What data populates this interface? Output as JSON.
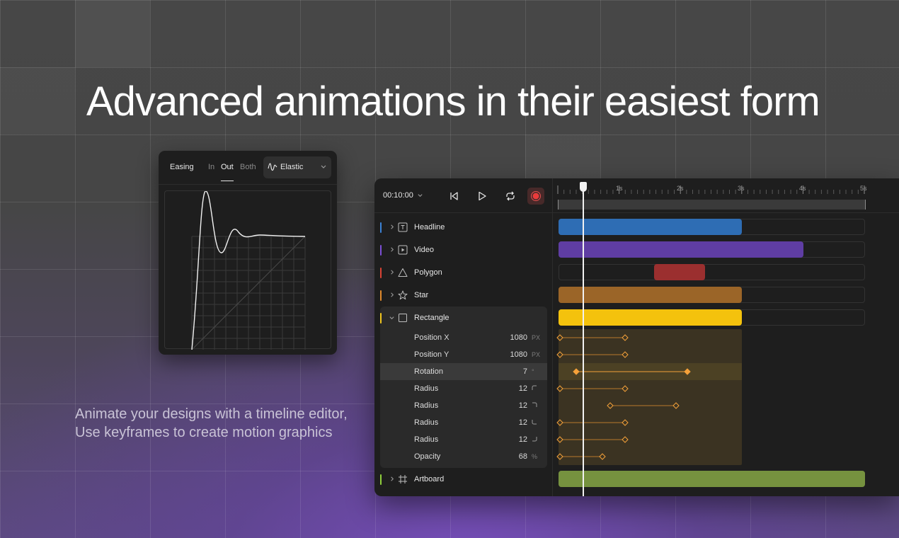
{
  "hero": {
    "headline": "Advanced animations in their easiest form",
    "subtext_line1": "Animate your designs with a timeline editor,",
    "subtext_line2": "Use keyframes to create motion graphics"
  },
  "easing_panel": {
    "title": "Easing",
    "tabs": [
      {
        "label": "In",
        "active": false
      },
      {
        "label": "Out",
        "active": true
      },
      {
        "label": "Both",
        "active": false
      }
    ],
    "preset_icon": "elastic-wave-icon",
    "preset": "Elastic"
  },
  "timeline": {
    "time": "00:10:00",
    "controls": [
      "skip-to-start-icon",
      "play-icon",
      "loop-icon",
      "record-icon"
    ],
    "ruler_labels": [
      "1s",
      "2s",
      "3s",
      "4s",
      "5s"
    ],
    "playhead_seconds": 0.4,
    "layers": [
      {
        "name": "Headline",
        "icon": "text-icon",
        "color": "#3b82d6",
        "expanded": false
      },
      {
        "name": "Video",
        "icon": "video-icon",
        "color": "#7c4fd6",
        "expanded": false
      },
      {
        "name": "Polygon",
        "icon": "triangle-icon",
        "color": "#d94335",
        "expanded": false
      },
      {
        "name": "Star",
        "icon": "star-icon",
        "color": "#e08a2c",
        "expanded": false
      },
      {
        "name": "Rectangle",
        "icon": "rectangle-icon",
        "color": "#f2c61f",
        "expanded": true
      },
      {
        "name": "Artboard",
        "icon": "artboard-icon",
        "color": "#8fcf3c",
        "expanded": false
      }
    ],
    "properties": [
      {
        "name": "Position X",
        "value": "1080",
        "unit": "PX"
      },
      {
        "name": "Position Y",
        "value": "1080",
        "unit": "PX"
      },
      {
        "name": "Rotation",
        "value": "7",
        "unit": "°",
        "selected": true
      },
      {
        "name": "Radius",
        "value": "12",
        "unit_icon": "corner-top-left-icon"
      },
      {
        "name": "Radius",
        "value": "12",
        "unit_icon": "corner-top-right-icon"
      },
      {
        "name": "Radius",
        "value": "12",
        "unit_icon": "corner-bottom-left-icon"
      },
      {
        "name": "Radius",
        "value": "12",
        "unit_icon": "corner-bottom-right-icon"
      },
      {
        "name": "Opacity",
        "value": "68",
        "unit": "%"
      }
    ],
    "clip_colors": {
      "Headline": "#2e6db4",
      "Video": "#5f3da3",
      "Polygon": "#9b2f2f",
      "Star": "#9b6528",
      "Rectangle": "#f4c20d",
      "Artboard": "#76923f"
    },
    "keyframe_color": "#f5a13a"
  }
}
